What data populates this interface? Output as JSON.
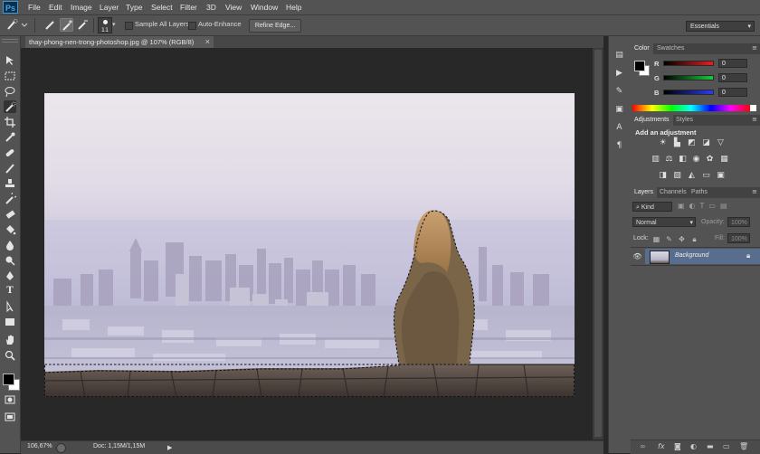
{
  "app": {
    "logo": "Ps"
  },
  "menu": [
    "File",
    "Edit",
    "Image",
    "Layer",
    "Type",
    "Select",
    "Filter",
    "3D",
    "View",
    "Window",
    "Help"
  ],
  "options": {
    "brush_size": "11",
    "sample_all_layers": "Sample All Layers",
    "auto_enhance": "Auto-Enhance",
    "refine_edge": "Refine Edge...",
    "workspace": "Essentials"
  },
  "document": {
    "tab_title": "thay-phong-nen-trong-photoshop.jpg @ 107% (RGB/8)",
    "close": "×",
    "zoom": "106,67%",
    "doc_info": "Doc: 1,15M/1,15M"
  },
  "color_panel": {
    "tabs": [
      "Color",
      "Swatches"
    ],
    "channels": [
      {
        "label": "R",
        "value": "0",
        "color": "#c0282a"
      },
      {
        "label": "G",
        "value": "0",
        "color": "#21b33a"
      },
      {
        "label": "B",
        "value": "0",
        "color": "#2a3ac9"
      }
    ]
  },
  "adjustments_panel": {
    "tabs": [
      "Adjustments",
      "Styles"
    ],
    "heading": "Add an adjustment"
  },
  "layers_panel": {
    "tabs": [
      "Layers",
      "Channels",
      "Paths"
    ],
    "filter_kind": "Kind",
    "blend_mode": "Normal",
    "opacity_label": "Opacity:",
    "opacity_value": "100%",
    "lock_label": "Lock:",
    "fill_label": "Fill:",
    "fill_value": "100%",
    "layers": [
      {
        "name": "Background"
      }
    ]
  },
  "colors": {
    "accent": "#3ea7f2",
    "selected_layer": "#596e8e"
  }
}
